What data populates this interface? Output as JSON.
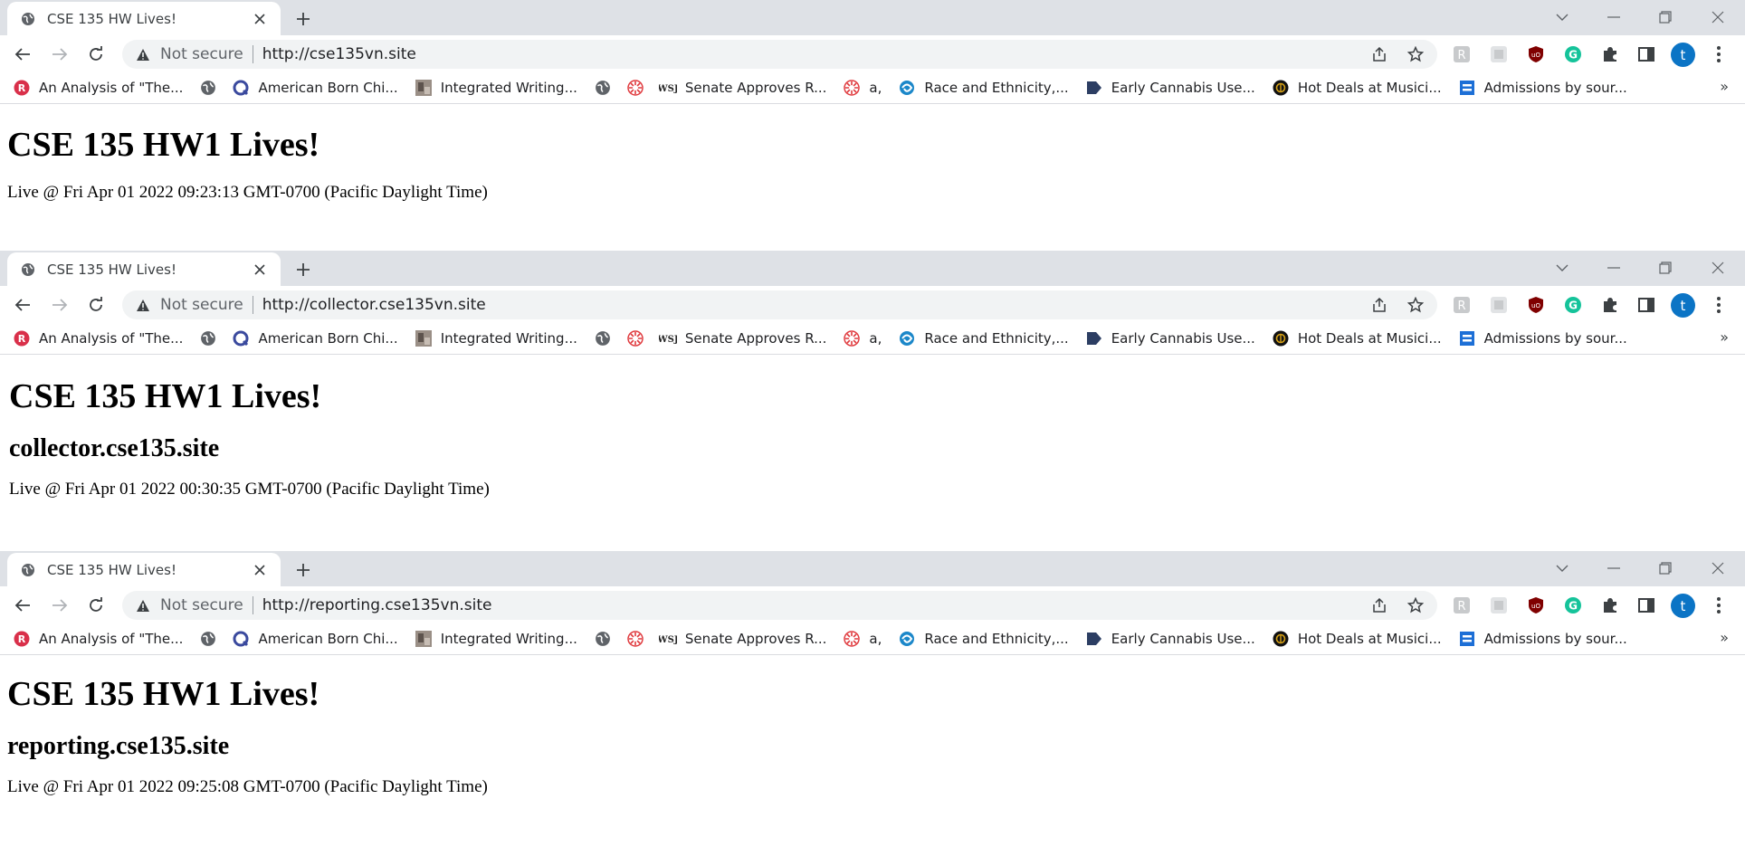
{
  "windows": [
    {
      "tab_title": "CSE 135 HW Lives!",
      "security_label": "Not secure",
      "url": "http://cse135vn.site",
      "heading": "CSE 135 HW1 Lives!",
      "subheading": "",
      "live_text": "Live @ Fri Apr 01 2022 09:23:13 GMT-0700 (Pacific Daylight Time)"
    },
    {
      "tab_title": "CSE 135 HW Lives!",
      "security_label": "Not secure",
      "url": "http://collector.cse135vn.site",
      "heading": "CSE 135 HW1 Lives!",
      "subheading": "collector.cse135.site",
      "live_text": "Live @ Fri Apr 01 2022 00:30:35 GMT-0700 (Pacific Daylight Time)"
    },
    {
      "tab_title": "CSE 135 HW Lives!",
      "security_label": "Not secure",
      "url": "http://reporting.cse135vn.site",
      "heading": "CSE 135 HW1 Lives!",
      "subheading": "reporting.cse135.site",
      "live_text": "Live @ Fri Apr 01 2022 09:25:08 GMT-0700 (Pacific Daylight Time)"
    }
  ],
  "bookmarks": [
    {
      "label": "An Analysis of \"The...",
      "icon": "r-circle-icon"
    },
    {
      "label": "",
      "icon": "globe-icon"
    },
    {
      "label": "American Born Chi...",
      "icon": "q-icon"
    },
    {
      "label": "Integrated Writing...",
      "icon": "photo-thumbnail-icon"
    },
    {
      "label": "",
      "icon": "globe-icon"
    },
    {
      "label": "",
      "icon": "red-asterisk-icon"
    },
    {
      "label": "Senate Approves R...",
      "icon": "wsj-icon"
    },
    {
      "label": "a,",
      "icon": "red-asterisk-icon"
    },
    {
      "label": "Race and Ethnicity,...",
      "icon": "swirl-icon"
    },
    {
      "label": "Early Cannabis Use...",
      "icon": "arrow-tag-icon"
    },
    {
      "label": "Hot Deals at Musici...",
      "icon": "gold-emblem-icon"
    },
    {
      "label": "Admissions by sour...",
      "icon": "blue-square-icon"
    }
  ],
  "avatar_letter": "t",
  "more_bookmarks": "»",
  "colors": {
    "accent": "#0b74c5",
    "tabbar": "#dee1e6",
    "omnibox": "#f1f3f4"
  }
}
